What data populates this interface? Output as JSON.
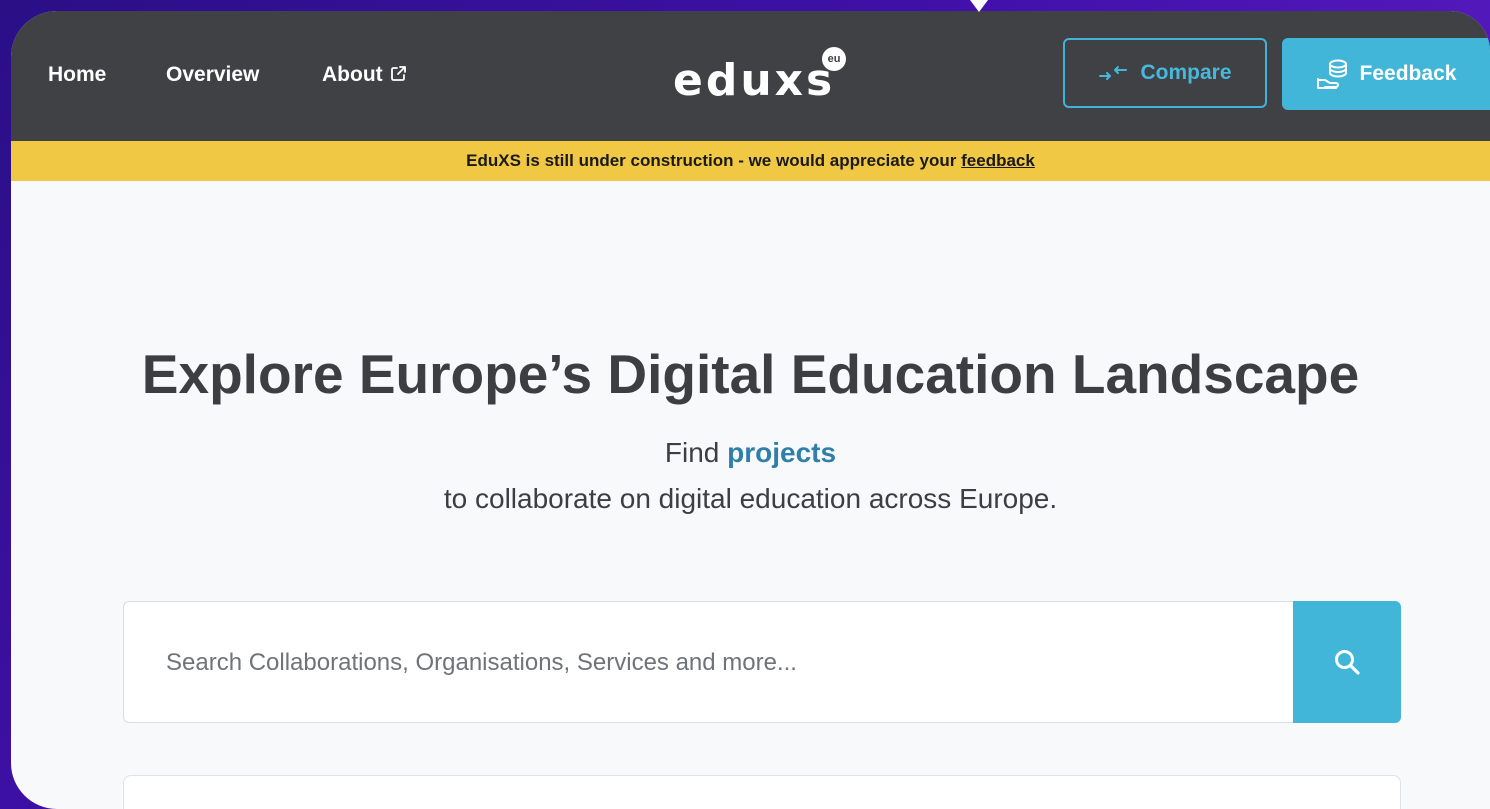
{
  "nav": {
    "home": "Home",
    "overview": "Overview",
    "about": "About"
  },
  "logo": {
    "text": "eduxs",
    "badge": "eu"
  },
  "buttons": {
    "compare": "Compare",
    "feedback": "Feedback"
  },
  "banner": {
    "text": "EduXS is still under construction - we would appreciate your ",
    "link": "feedback"
  },
  "hero": {
    "title": "Explore Europe’s Digital Education Landscape",
    "find_prefix": "Find",
    "find_highlight": "projects",
    "subtitle": "to collaborate on digital education across Europe."
  },
  "search": {
    "placeholder": "Search Collaborations, Organisations, Services and more..."
  },
  "icons": {
    "external_link": "external-link-icon",
    "compare": "arrows-compare-icon",
    "feedback": "hand-database-icon",
    "search": "search-icon"
  },
  "colors": {
    "navbar": "#404144",
    "accent": "#42b6d9",
    "banner": "#f1c844",
    "highlight": "#2f7fa8",
    "text_dark": "#3d3e42"
  }
}
